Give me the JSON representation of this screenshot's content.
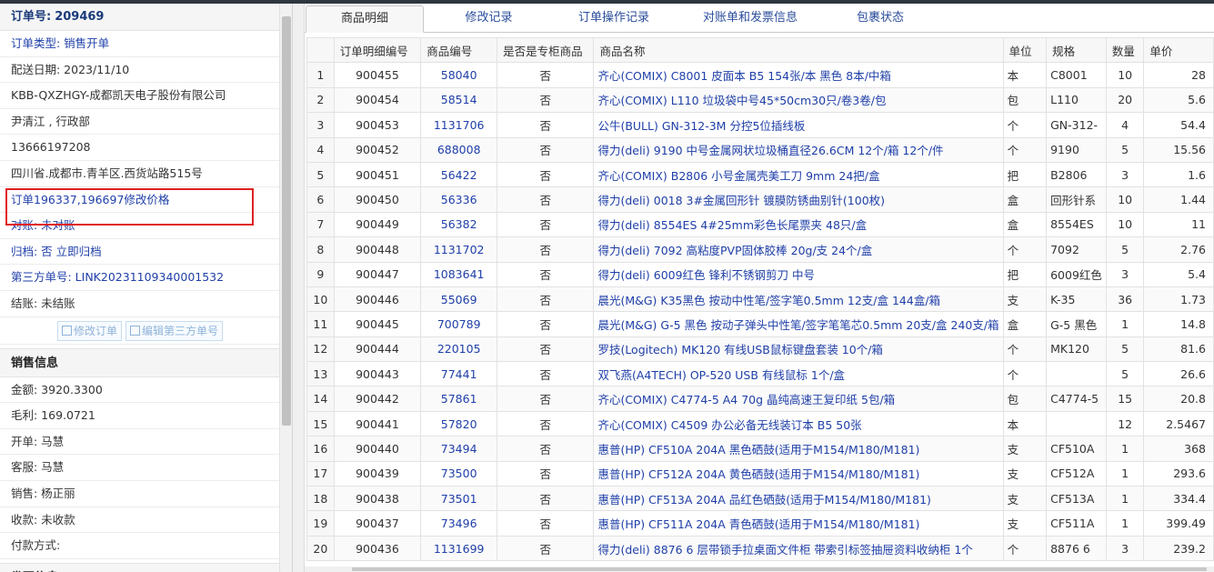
{
  "order": {
    "title_label": "订单号:",
    "number": "209469",
    "fields": [
      {
        "text": "订单类型: 销售开单",
        "style": "blue"
      },
      {
        "text": "配送日期: 2023/11/10",
        "style": "plain"
      },
      {
        "text": "KBB-QXZHGY-成都凯天电子股份有限公司",
        "style": "plain"
      },
      {
        "text": "尹清江 , 行政部",
        "style": "plain"
      },
      {
        "text": "13666197208",
        "style": "plain"
      },
      {
        "text": "四川省.成都市.青羊区.西货站路515号",
        "style": "plain"
      },
      {
        "text": "订单196337,196697修改价格",
        "style": "blue"
      },
      {
        "text": "对账: 未对账",
        "style": "blue"
      },
      {
        "text": "归档: 否 立即归档",
        "style": "blue"
      },
      {
        "text": "第三方单号: LINK20231109340001532",
        "style": "blue"
      },
      {
        "text": "结账: 未结账",
        "style": "plain"
      }
    ],
    "buttons": {
      "edit_order": "修改订单",
      "edit_third": "编辑第三方单号"
    }
  },
  "sales": {
    "title": "销售信息",
    "fields": [
      "金额: 3920.3300",
      "毛利: 169.0721",
      "开单: 马慧",
      "客服: 马慧",
      "销售: 杨正丽",
      "收款: 未收款",
      "付款方式:"
    ],
    "next_title": "发票信息"
  },
  "tabs": [
    "商品明细",
    "修改记录",
    "订单操作记录",
    "对账单和发票信息",
    "包裹状态"
  ],
  "table": {
    "headers": [
      "",
      "订单明细编号",
      "商品编号",
      "是否是专柜商品",
      "商品名称",
      "单位",
      "规格",
      "数量",
      "单价"
    ],
    "rows": [
      [
        "1",
        "900455",
        "58040",
        "否",
        "齐心(COMIX) C8001 皮面本 B5 154张/本 黑色 8本/中箱",
        "本",
        "C8001",
        "10",
        "28"
      ],
      [
        "2",
        "900454",
        "58514",
        "否",
        "齐心(COMIX) L110 垃圾袋中号45*50cm30只/卷3卷/包",
        "包",
        "L110",
        "20",
        "5.6"
      ],
      [
        "3",
        "900453",
        "1131706",
        "否",
        "公牛(BULL) GN-312-3M 分控5位插线板",
        "个",
        "GN-312-",
        "4",
        "54.4"
      ],
      [
        "4",
        "900452",
        "688008",
        "否",
        "得力(deli) 9190 中号金属网状垃圾桶直径26.6CM 12个/箱 12个/件",
        "个",
        "9190",
        "5",
        "15.56"
      ],
      [
        "5",
        "900451",
        "56422",
        "否",
        "齐心(COMIX) B2806 小号金属壳美工刀 9mm 24把/盒",
        "把",
        "B2806",
        "3",
        "1.6"
      ],
      [
        "6",
        "900450",
        "56336",
        "否",
        "得力(deli) 0018 3#金属回形针 镀膜防锈曲别针(100枚)",
        "盒",
        "回形针系",
        "10",
        "1.44"
      ],
      [
        "7",
        "900449",
        "56382",
        "否",
        "得力(deli) 8554ES 4#25mm彩色长尾票夹 48只/盒",
        "盒",
        "8554ES",
        "10",
        "11"
      ],
      [
        "8",
        "900448",
        "1131702",
        "否",
        "得力(deli) 7092 高粘度PVP固体胶棒 20g/支 24个/盒",
        "个",
        "7092",
        "5",
        "2.76"
      ],
      [
        "9",
        "900447",
        "1083641",
        "否",
        "得力(deli) 6009红色 锋利不锈钢剪刀 中号",
        "把",
        "6009红色",
        "3",
        "5.4"
      ],
      [
        "10",
        "900446",
        "55069",
        "否",
        "晨光(M&G) K35黑色 按动中性笔/签字笔0.5mm 12支/盒 144盒/箱",
        "支",
        "K-35",
        "36",
        "1.73"
      ],
      [
        "11",
        "900445",
        "700789",
        "否",
        "晨光(M&G) G-5 黑色 按动子弹头中性笔/签字笔笔芯0.5mm 20支/盒 240支/箱",
        "盒",
        "G-5 黑色",
        "1",
        "14.8"
      ],
      [
        "12",
        "900444",
        "220105",
        "否",
        "罗技(Logitech) MK120 有线USB鼠标键盘套装 10个/箱",
        "个",
        "MK120",
        "5",
        "81.6"
      ],
      [
        "13",
        "900443",
        "77441",
        "否",
        "双飞燕(A4TECH) OP-520 USB 有线鼠标 1个/盒",
        "个",
        "",
        "5",
        "26.6"
      ],
      [
        "14",
        "900442",
        "57861",
        "否",
        "齐心(COMIX) C4774-5 A4 70g 晶纯高速王复印纸 5包/箱",
        "包",
        "C4774-5",
        "15",
        "20.8"
      ],
      [
        "15",
        "900441",
        "57820",
        "否",
        "齐心(COMIX) C4509 办公必备无线装订本 B5 50张",
        "本",
        "",
        "12",
        "2.5467"
      ],
      [
        "16",
        "900440",
        "73494",
        "否",
        "惠普(HP) CF510A 204A 黑色硒鼓(适用于M154/M180/M181)",
        "支",
        "CF510A",
        "1",
        "368"
      ],
      [
        "17",
        "900439",
        "73500",
        "否",
        "惠普(HP) CF512A 204A 黄色硒鼓(适用于M154/M180/M181)",
        "支",
        "CF512A",
        "1",
        "293.6"
      ],
      [
        "18",
        "900438",
        "73501",
        "否",
        "惠普(HP) CF513A 204A 品红色硒鼓(适用于M154/M180/M181)",
        "支",
        "CF513A",
        "1",
        "334.4"
      ],
      [
        "19",
        "900437",
        "73496",
        "否",
        "惠普(HP) CF511A 204A 青色硒鼓(适用于M154/M180/M181)",
        "支",
        "CF511A",
        "1",
        "399.49"
      ],
      [
        "20",
        "900436",
        "1131699",
        "否",
        "得力(deli) 8876 6 层带锁手拉桌面文件柜 带索引标签抽屉资料收纳柜 1个",
        "个",
        "8876 6",
        "3",
        "239.2"
      ]
    ]
  }
}
